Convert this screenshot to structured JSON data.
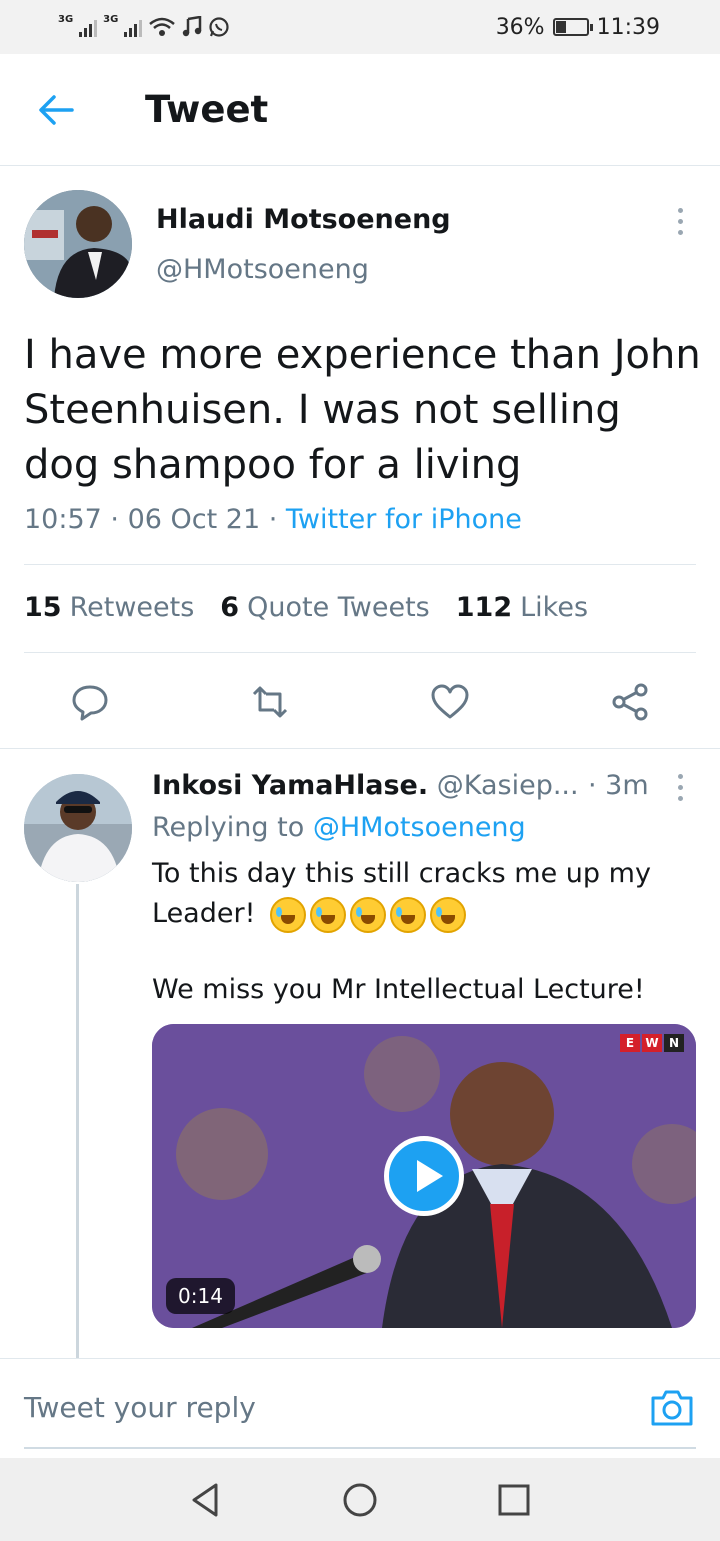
{
  "status_bar": {
    "net1": "3G",
    "net2": "3G",
    "battery": "36%",
    "battery_level": 0.36,
    "time": "11:39"
  },
  "header": {
    "title": "Tweet"
  },
  "tweet": {
    "author_name": "Hlaudi Motsoeneng",
    "author_handle": "@HMotsoeneng",
    "text": "I have more experience than John Steenhuisen. I was not selling dog shampoo for a living",
    "time": "10:57",
    "date": "06 Oct 21",
    "source": "Twitter for iPhone",
    "stats": {
      "retweets_count": "15",
      "retweets_label": "Retweets",
      "quotes_count": "6",
      "quotes_label": "Quote Tweets",
      "likes_count": "112",
      "likes_label": "Likes"
    }
  },
  "reply": {
    "author_name": "Inkosi YamaHlase.",
    "author_handle": "@Kasiep...",
    "time": "· 3m",
    "replying_prefix": "Replying to",
    "replying_to": "@HMotsoeneng",
    "line1": "To this day this still cracks me up my Leader!",
    "line2": "We miss you Mr Intellectual Lecture!",
    "video_duration": "0:14",
    "video_badge": [
      "E",
      "W",
      "N"
    ]
  },
  "composer": {
    "placeholder": "Tweet your reply"
  },
  "colors": {
    "accent": "#1da1f2",
    "muted": "#657786",
    "text": "#14171a"
  }
}
